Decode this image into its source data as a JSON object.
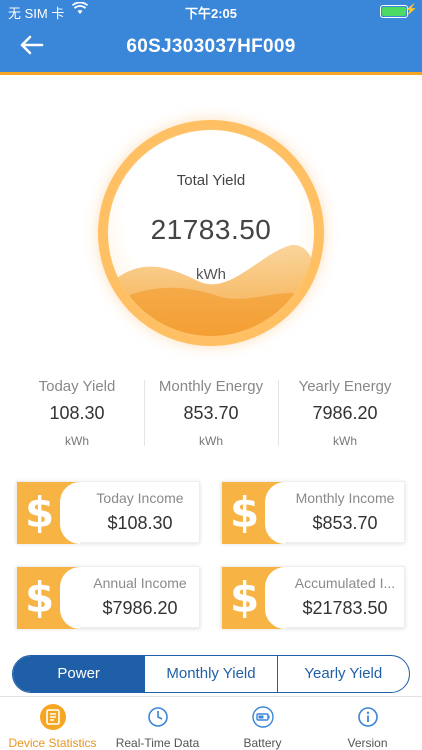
{
  "status_bar": {
    "carrier": "无 SIM 卡",
    "time": "下午2:05"
  },
  "header": {
    "title": "60SJ303037HF009"
  },
  "gauge": {
    "label": "Total Yield",
    "value": "21783.50",
    "unit": "kWh"
  },
  "stats": [
    {
      "title": "Today Yield",
      "value": "108.30",
      "unit": "kWh"
    },
    {
      "title": "Monthly Energy",
      "value": "853.70",
      "unit": "kWh"
    },
    {
      "title": "Yearly Energy",
      "value": "7986.20",
      "unit": "kWh"
    }
  ],
  "income": [
    {
      "title": "Today Income",
      "value": "$108.30",
      "icon": "dollar-icon"
    },
    {
      "title": "Monthly Income",
      "value": "$853.70",
      "icon": "dollar-icon"
    },
    {
      "title": "Annual Income",
      "value": "$7986.20",
      "icon": "dollar-icon"
    },
    {
      "title": "Accumulated I...",
      "value": "$21783.50",
      "icon": "dollar-icon"
    }
  ],
  "segments": {
    "items": [
      "Power",
      "Monthly Yield",
      "Yearly Yield"
    ],
    "selected": "Power"
  },
  "tabs": [
    {
      "label": "Device Statistics",
      "icon": "statistics-icon",
      "active": true
    },
    {
      "label": "Real-Time Data",
      "icon": "clock-icon",
      "active": false
    },
    {
      "label": "Battery",
      "icon": "battery-icon",
      "active": false
    },
    {
      "label": "Version",
      "icon": "info-icon",
      "active": false
    }
  ],
  "colors": {
    "header": "#3a86d8",
    "accent": "#f5a623",
    "segment": "#1f5fa8",
    "card_badge": "#f7b444"
  }
}
